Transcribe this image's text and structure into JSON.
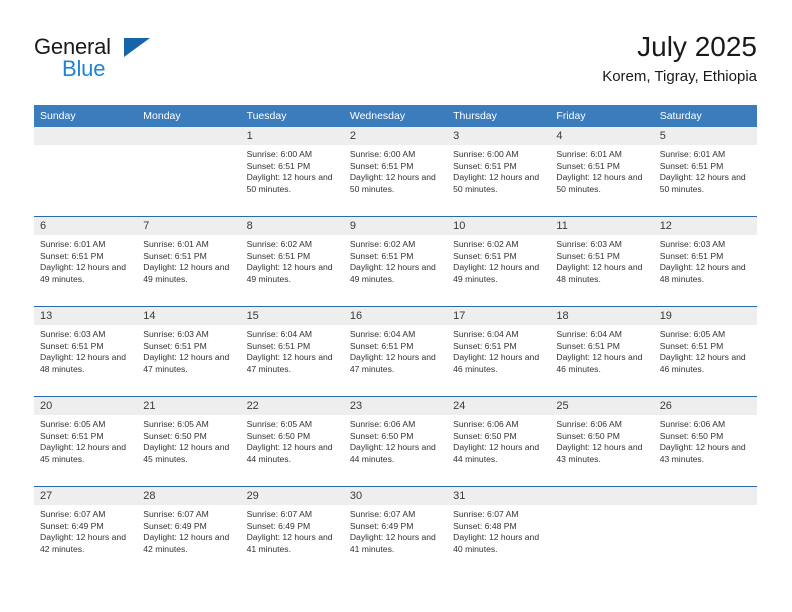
{
  "brand": {
    "name_top": "General",
    "name_bottom": "Blue",
    "flag_icon": "triangle-flag-icon",
    "accent_color": "#1f84d6",
    "flag_color": "#1565a8"
  },
  "header": {
    "title": "July 2025",
    "subtitle": "Korem, Tigray, Ethiopia"
  },
  "calendar": {
    "header_bg": "#3b7cbc",
    "daynum_bg": "#eeeeee",
    "separator_color": "#2a6aad",
    "weekday_headers": [
      "Sunday",
      "Monday",
      "Tuesday",
      "Wednesday",
      "Thursday",
      "Friday",
      "Saturday"
    ],
    "labels": {
      "sunrise": "Sunrise:",
      "sunset": "Sunset:",
      "daylight": "Daylight:"
    },
    "weeks": [
      [
        {
          "day": "",
          "sunrise": "",
          "sunset": "",
          "daylight": ""
        },
        {
          "day": "",
          "sunrise": "",
          "sunset": "",
          "daylight": ""
        },
        {
          "day": "1",
          "sunrise": "Sunrise: 6:00 AM",
          "sunset": "Sunset: 6:51 PM",
          "daylight": "Daylight: 12 hours and 50 minutes."
        },
        {
          "day": "2",
          "sunrise": "Sunrise: 6:00 AM",
          "sunset": "Sunset: 6:51 PM",
          "daylight": "Daylight: 12 hours and 50 minutes."
        },
        {
          "day": "3",
          "sunrise": "Sunrise: 6:00 AM",
          "sunset": "Sunset: 6:51 PM",
          "daylight": "Daylight: 12 hours and 50 minutes."
        },
        {
          "day": "4",
          "sunrise": "Sunrise: 6:01 AM",
          "sunset": "Sunset: 6:51 PM",
          "daylight": "Daylight: 12 hours and 50 minutes."
        },
        {
          "day": "5",
          "sunrise": "Sunrise: 6:01 AM",
          "sunset": "Sunset: 6:51 PM",
          "daylight": "Daylight: 12 hours and 50 minutes."
        }
      ],
      [
        {
          "day": "6",
          "sunrise": "Sunrise: 6:01 AM",
          "sunset": "Sunset: 6:51 PM",
          "daylight": "Daylight: 12 hours and 49 minutes."
        },
        {
          "day": "7",
          "sunrise": "Sunrise: 6:01 AM",
          "sunset": "Sunset: 6:51 PM",
          "daylight": "Daylight: 12 hours and 49 minutes."
        },
        {
          "day": "8",
          "sunrise": "Sunrise: 6:02 AM",
          "sunset": "Sunset: 6:51 PM",
          "daylight": "Daylight: 12 hours and 49 minutes."
        },
        {
          "day": "9",
          "sunrise": "Sunrise: 6:02 AM",
          "sunset": "Sunset: 6:51 PM",
          "daylight": "Daylight: 12 hours and 49 minutes."
        },
        {
          "day": "10",
          "sunrise": "Sunrise: 6:02 AM",
          "sunset": "Sunset: 6:51 PM",
          "daylight": "Daylight: 12 hours and 49 minutes."
        },
        {
          "day": "11",
          "sunrise": "Sunrise: 6:03 AM",
          "sunset": "Sunset: 6:51 PM",
          "daylight": "Daylight: 12 hours and 48 minutes."
        },
        {
          "day": "12",
          "sunrise": "Sunrise: 6:03 AM",
          "sunset": "Sunset: 6:51 PM",
          "daylight": "Daylight: 12 hours and 48 minutes."
        }
      ],
      [
        {
          "day": "13",
          "sunrise": "Sunrise: 6:03 AM",
          "sunset": "Sunset: 6:51 PM",
          "daylight": "Daylight: 12 hours and 48 minutes."
        },
        {
          "day": "14",
          "sunrise": "Sunrise: 6:03 AM",
          "sunset": "Sunset: 6:51 PM",
          "daylight": "Daylight: 12 hours and 47 minutes."
        },
        {
          "day": "15",
          "sunrise": "Sunrise: 6:04 AM",
          "sunset": "Sunset: 6:51 PM",
          "daylight": "Daylight: 12 hours and 47 minutes."
        },
        {
          "day": "16",
          "sunrise": "Sunrise: 6:04 AM",
          "sunset": "Sunset: 6:51 PM",
          "daylight": "Daylight: 12 hours and 47 minutes."
        },
        {
          "day": "17",
          "sunrise": "Sunrise: 6:04 AM",
          "sunset": "Sunset: 6:51 PM",
          "daylight": "Daylight: 12 hours and 46 minutes."
        },
        {
          "day": "18",
          "sunrise": "Sunrise: 6:04 AM",
          "sunset": "Sunset: 6:51 PM",
          "daylight": "Daylight: 12 hours and 46 minutes."
        },
        {
          "day": "19",
          "sunrise": "Sunrise: 6:05 AM",
          "sunset": "Sunset: 6:51 PM",
          "daylight": "Daylight: 12 hours and 46 minutes."
        }
      ],
      [
        {
          "day": "20",
          "sunrise": "Sunrise: 6:05 AM",
          "sunset": "Sunset: 6:51 PM",
          "daylight": "Daylight: 12 hours and 45 minutes."
        },
        {
          "day": "21",
          "sunrise": "Sunrise: 6:05 AM",
          "sunset": "Sunset: 6:50 PM",
          "daylight": "Daylight: 12 hours and 45 minutes."
        },
        {
          "day": "22",
          "sunrise": "Sunrise: 6:05 AM",
          "sunset": "Sunset: 6:50 PM",
          "daylight": "Daylight: 12 hours and 44 minutes."
        },
        {
          "day": "23",
          "sunrise": "Sunrise: 6:06 AM",
          "sunset": "Sunset: 6:50 PM",
          "daylight": "Daylight: 12 hours and 44 minutes."
        },
        {
          "day": "24",
          "sunrise": "Sunrise: 6:06 AM",
          "sunset": "Sunset: 6:50 PM",
          "daylight": "Daylight: 12 hours and 44 minutes."
        },
        {
          "day": "25",
          "sunrise": "Sunrise: 6:06 AM",
          "sunset": "Sunset: 6:50 PM",
          "daylight": "Daylight: 12 hours and 43 minutes."
        },
        {
          "day": "26",
          "sunrise": "Sunrise: 6:06 AM",
          "sunset": "Sunset: 6:50 PM",
          "daylight": "Daylight: 12 hours and 43 minutes."
        }
      ],
      [
        {
          "day": "27",
          "sunrise": "Sunrise: 6:07 AM",
          "sunset": "Sunset: 6:49 PM",
          "daylight": "Daylight: 12 hours and 42 minutes."
        },
        {
          "day": "28",
          "sunrise": "Sunrise: 6:07 AM",
          "sunset": "Sunset: 6:49 PM",
          "daylight": "Daylight: 12 hours and 42 minutes."
        },
        {
          "day": "29",
          "sunrise": "Sunrise: 6:07 AM",
          "sunset": "Sunset: 6:49 PM",
          "daylight": "Daylight: 12 hours and 41 minutes."
        },
        {
          "day": "30",
          "sunrise": "Sunrise: 6:07 AM",
          "sunset": "Sunset: 6:49 PM",
          "daylight": "Daylight: 12 hours and 41 minutes."
        },
        {
          "day": "31",
          "sunrise": "Sunrise: 6:07 AM",
          "sunset": "Sunset: 6:48 PM",
          "daylight": "Daylight: 12 hours and 40 minutes."
        },
        {
          "day": "",
          "sunrise": "",
          "sunset": "",
          "daylight": ""
        },
        {
          "day": "",
          "sunrise": "",
          "sunset": "",
          "daylight": ""
        }
      ]
    ]
  }
}
